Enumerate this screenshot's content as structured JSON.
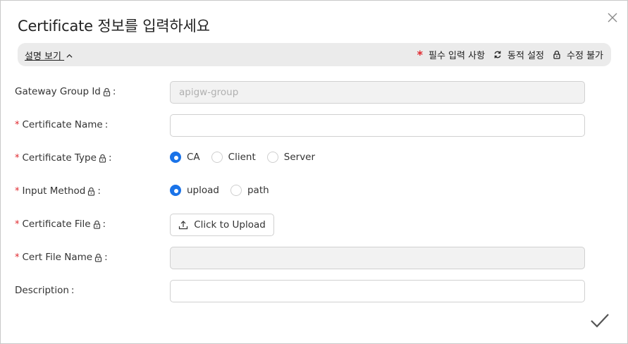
{
  "dialog": {
    "title": "Certificate 정보를 입력하세요",
    "close_icon": "close-icon",
    "confirm_icon": "checkmark-icon"
  },
  "banner": {
    "help_toggle": "설명 보기",
    "help_toggle_icon": "chevron-up-icon",
    "required_legend": "필수 입력 사항",
    "dynamic_legend": "동적 설정",
    "dynamic_icon": "refresh-icon",
    "readonly_legend": "수정 불가",
    "readonly_icon": "lock-icon",
    "required_color": "#e0282e"
  },
  "form": {
    "gateway_group_id": {
      "label": "Gateway Group Id",
      "required": false,
      "locked": true,
      "value": "apigw-group"
    },
    "certificate_name": {
      "label": "Certificate Name",
      "required": true,
      "locked": false,
      "value": ""
    },
    "certificate_type": {
      "label": "Certificate Type",
      "required": true,
      "locked": true,
      "options": [
        "CA",
        "Client",
        "Server"
      ],
      "selected": "CA"
    },
    "input_method": {
      "label": "Input Method",
      "required": true,
      "locked": true,
      "options": [
        "upload",
        "path"
      ],
      "selected": "upload"
    },
    "certificate_file": {
      "label": "Certificate File",
      "required": true,
      "locked": true,
      "button_label": "Click to Upload",
      "button_icon": "upload-icon"
    },
    "cert_file_name": {
      "label": "Cert File Name",
      "required": true,
      "locked": true,
      "value": ""
    },
    "description": {
      "label": "Description",
      "required": false,
      "locked": false,
      "value": ""
    }
  },
  "colors": {
    "accent": "#1a73e8",
    "required": "#e0282e"
  }
}
